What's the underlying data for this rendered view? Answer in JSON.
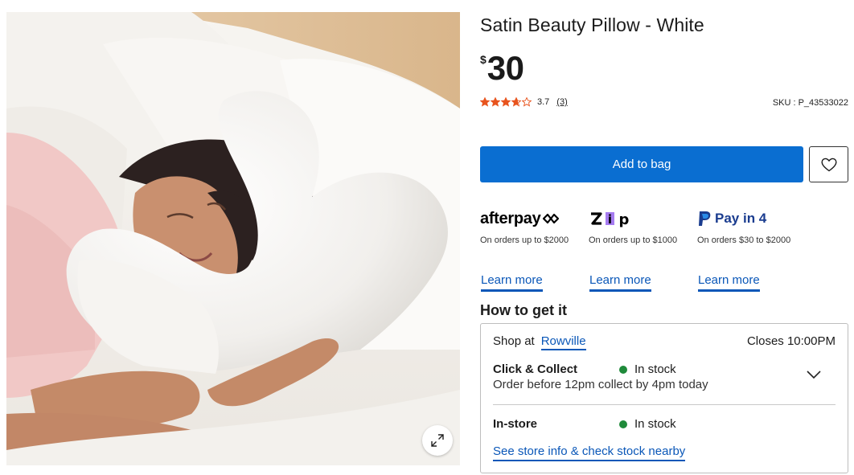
{
  "product": {
    "title": "Satin Beauty Pillow - White",
    "price_currency": "$",
    "price_amount": "30",
    "rating_value": 3.7,
    "rating_text": "3.7",
    "review_count": "(3)",
    "sku": "SKU : P_43533022",
    "image_alt": "Woman sleeping on a white satin beauty pillow"
  },
  "actions": {
    "add_to_bag": "Add to bag",
    "wishlist_icon": "heart-icon",
    "expand_icon": "expand-icon"
  },
  "payments": [
    {
      "brand": "afterpay",
      "note": "On orders up to $2000",
      "learn": "Learn more"
    },
    {
      "brand": "zip",
      "note": "On orders up to $1000",
      "learn": "Learn more"
    },
    {
      "brand": "Pay in 4",
      "note": "On orders $30 to $2000",
      "learn": "Learn more"
    }
  ],
  "fulfilment": {
    "title": "How to get it",
    "shop_at_label": "Shop at",
    "store_name": "Rowville",
    "closes": "Closes 10:00PM",
    "click_collect_label": "Click & Collect",
    "click_collect_stock": "In stock",
    "click_collect_note": "Order before 12pm collect by 4pm today",
    "instore_label": "In-store",
    "instore_stock": "In stock",
    "store_info_link": "See store info & check stock nearby"
  },
  "colors": {
    "primary": "#0a6ed1",
    "link": "#0a57b8",
    "star": "#e8541e",
    "in_stock": "#1f8a3a"
  }
}
